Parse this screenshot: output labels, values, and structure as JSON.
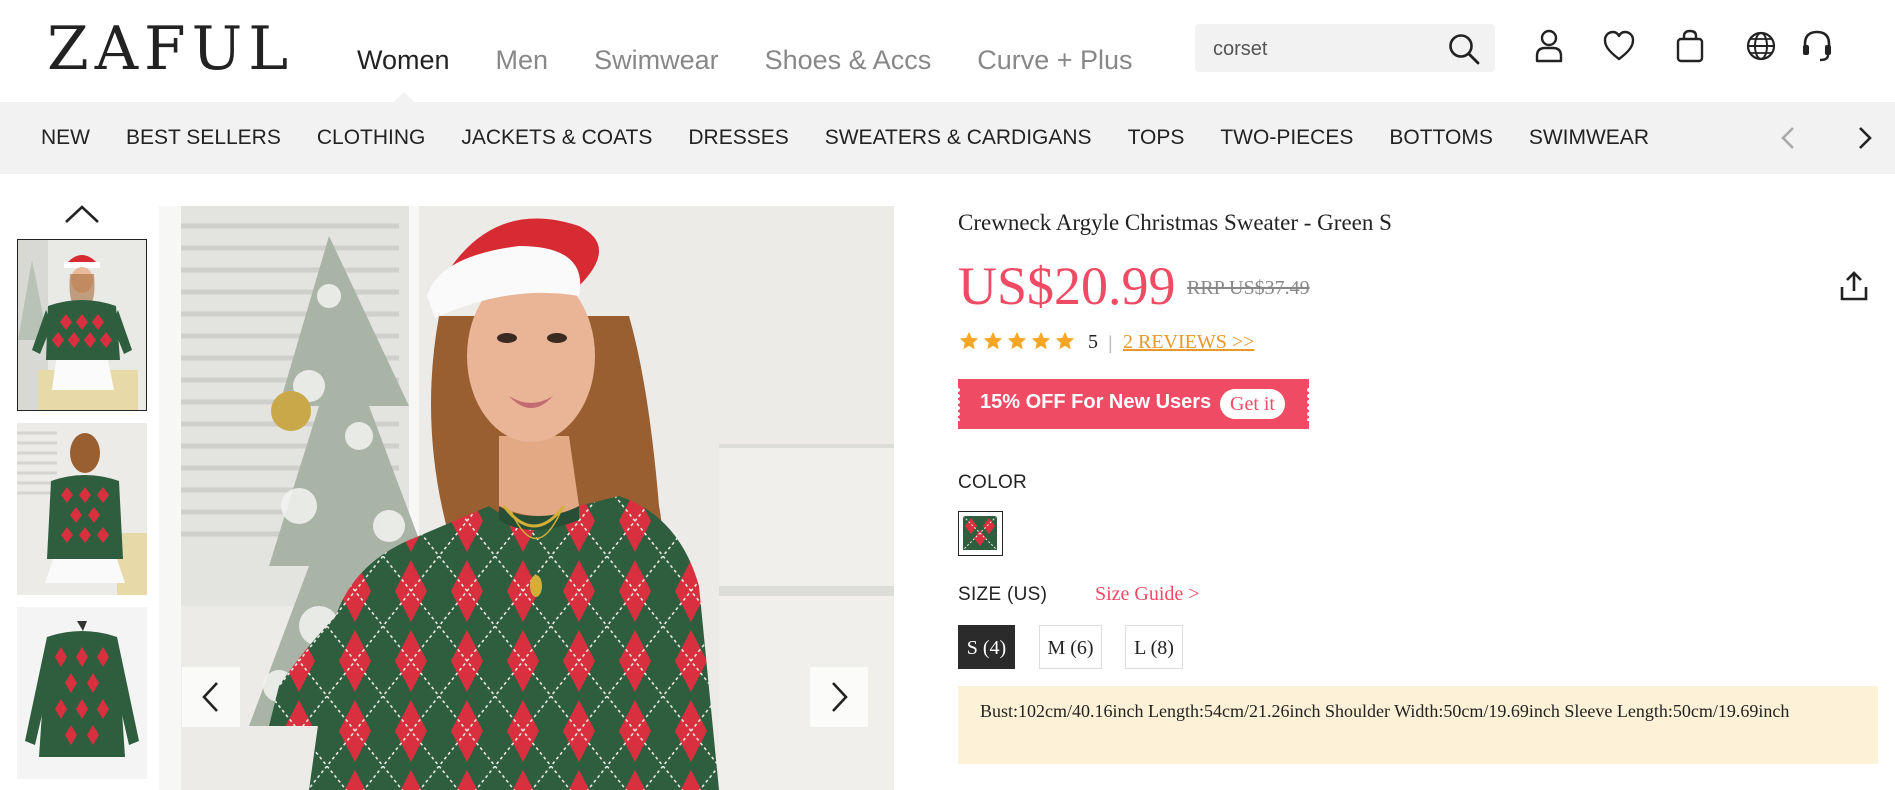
{
  "header": {
    "logo": "ZAFUL",
    "nav": [
      "Women",
      "Men",
      "Swimwear",
      "Shoes & Accs",
      "Curve + Plus"
    ],
    "active_nav": "Women",
    "search": {
      "value": "corset",
      "placeholder": "corset"
    },
    "icons": [
      "search-icon",
      "account-icon",
      "wishlist-icon",
      "bag-icon",
      "globe-icon",
      "support-headset-icon"
    ]
  },
  "categories": {
    "items": [
      "NEW",
      "BEST SELLERS",
      "CLOTHING",
      "JACKETS & COATS",
      "DRESSES",
      "SWEATERS & CARDIGANS",
      "TOPS",
      "TWO-PIECES",
      "BOTTOMS",
      "SWIMWEAR"
    ]
  },
  "product": {
    "title": "Crewneck Argyle Christmas Sweater - Green S",
    "price": "US$20.99",
    "rrp": "RRP US$37.49",
    "rating": 5,
    "rating_text": "5",
    "separator": "|",
    "reviews_link": "2 REVIEWS >>",
    "promo": {
      "text": "15% OFF For New Users",
      "button": "Get it"
    },
    "color_label": "COLOR",
    "size_label": "SIZE (US)",
    "size_guide": "Size Guide >",
    "sizes": [
      "S (4)",
      "M (6)",
      "L (8)"
    ],
    "selected_size": "S (4)",
    "measurements": "Bust:102cm/40.16inch   Length:54cm/21.26inch   Shoulder Width:50cm/19.69inch   Sleeve Length:50cm/19.69inch"
  },
  "colors": {
    "accent": "#f04b65",
    "review_link": "#e8992b",
    "star": "#f5a623",
    "sweater_green": "#2f5e3f",
    "argyle_red": "#d9303f",
    "measure_bg": "#fdf1d7",
    "category_bar": "#f2f2f2"
  }
}
